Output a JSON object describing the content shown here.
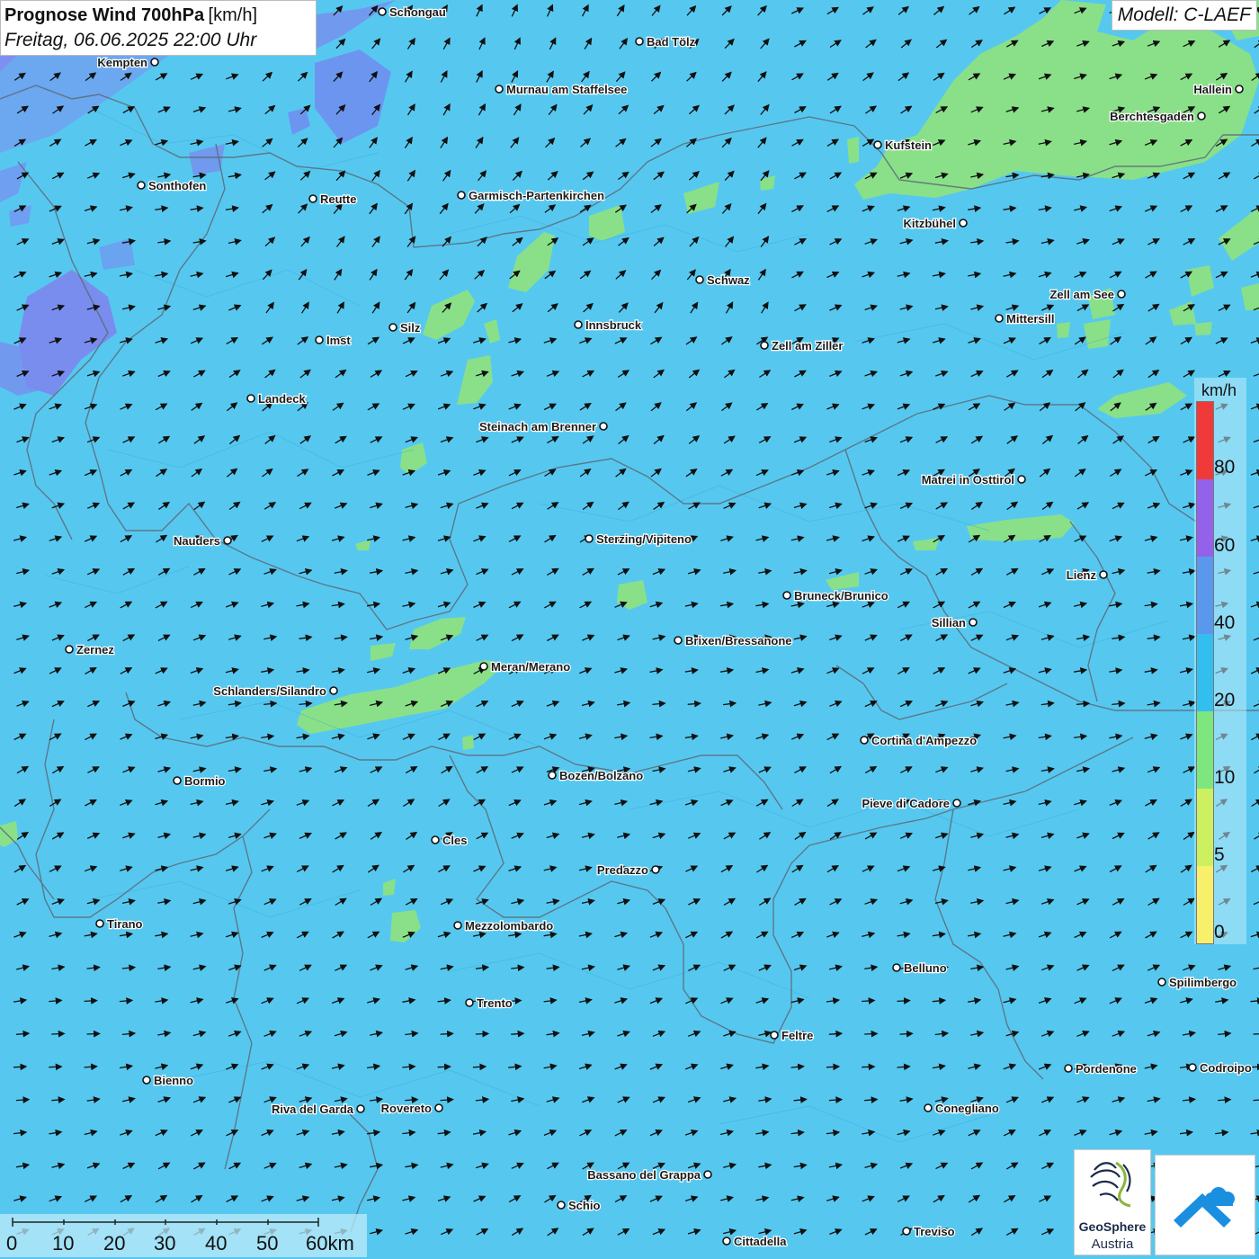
{
  "header": {
    "title": "Prognose Wind 700hPa",
    "unit": "[km/h]",
    "datetime": "Freitag, 06.06.2025 22:00 Uhr"
  },
  "model": "Modell: C-LAEF",
  "legend": {
    "unit": "km/h",
    "ticks": [
      "80",
      "60",
      "40",
      "20",
      "10",
      "5",
      "0"
    ],
    "colors": [
      "#f03a3a",
      "#9461ea",
      "#5a98ee",
      "#32bff0",
      "#7ee67e",
      "#cdf060",
      "#f8f06a"
    ]
  },
  "scale": {
    "labels": [
      "0",
      "10",
      "20",
      "30",
      "40",
      "50",
      "60km"
    ]
  },
  "logos": {
    "geosphere_name": "GeoSphere",
    "geosphere_sub": "Austria"
  },
  "wind": {
    "dominant_direction": "south-west",
    "dominant_band": "20-40 km/h",
    "arrow_color": "#111111"
  },
  "cities": [
    {
      "name": "Schongau"
    },
    {
      "name": "Bad Tölz"
    },
    {
      "name": "Kempten"
    },
    {
      "name": "Murnau am Staffelsee"
    },
    {
      "name": "Hallein"
    },
    {
      "name": "Berchtesgaden"
    },
    {
      "name": "Kufstein"
    },
    {
      "name": "Sonthofen"
    },
    {
      "name": "Reutte"
    },
    {
      "name": "Garmisch-Partenkirchen"
    },
    {
      "name": "Kitzbühel"
    },
    {
      "name": "Schwaz"
    },
    {
      "name": "Zell am See"
    },
    {
      "name": "Silz"
    },
    {
      "name": "Innsbruck"
    },
    {
      "name": "Mittersill"
    },
    {
      "name": "Imst"
    },
    {
      "name": "Zell am Ziller"
    },
    {
      "name": "Landeck"
    },
    {
      "name": "Steinach am Brenner"
    },
    {
      "name": "Matrei in Osttirol"
    },
    {
      "name": "Nauders"
    },
    {
      "name": "Sterzing/Vipiteno"
    },
    {
      "name": "Lienz"
    },
    {
      "name": "Bruneck/Brunico"
    },
    {
      "name": "Sillian"
    },
    {
      "name": "Brixen/Bressanone"
    },
    {
      "name": "Zernez"
    },
    {
      "name": "Meran/Merano"
    },
    {
      "name": "Schlanders/Silandro"
    },
    {
      "name": "Cortina d'Ampezzo"
    },
    {
      "name": "Bozen/Bolzano"
    },
    {
      "name": "Bormio"
    },
    {
      "name": "Pieve di Cadore"
    },
    {
      "name": "Cles"
    },
    {
      "name": "Predazzo"
    },
    {
      "name": "Tirano"
    },
    {
      "name": "Mezzolombardo"
    },
    {
      "name": "Belluno"
    },
    {
      "name": "Spilimbergo"
    },
    {
      "name": "Trento"
    },
    {
      "name": "Feltre"
    },
    {
      "name": "Bienno"
    },
    {
      "name": "Pordenone"
    },
    {
      "name": "Codroipo"
    },
    {
      "name": "Riva del Garda"
    },
    {
      "name": "Rovereto"
    },
    {
      "name": "Conegliano"
    },
    {
      "name": "Bassano del Grappa"
    },
    {
      "name": "Schio"
    },
    {
      "name": "Treviso"
    },
    {
      "name": "Cittadella"
    }
  ]
}
